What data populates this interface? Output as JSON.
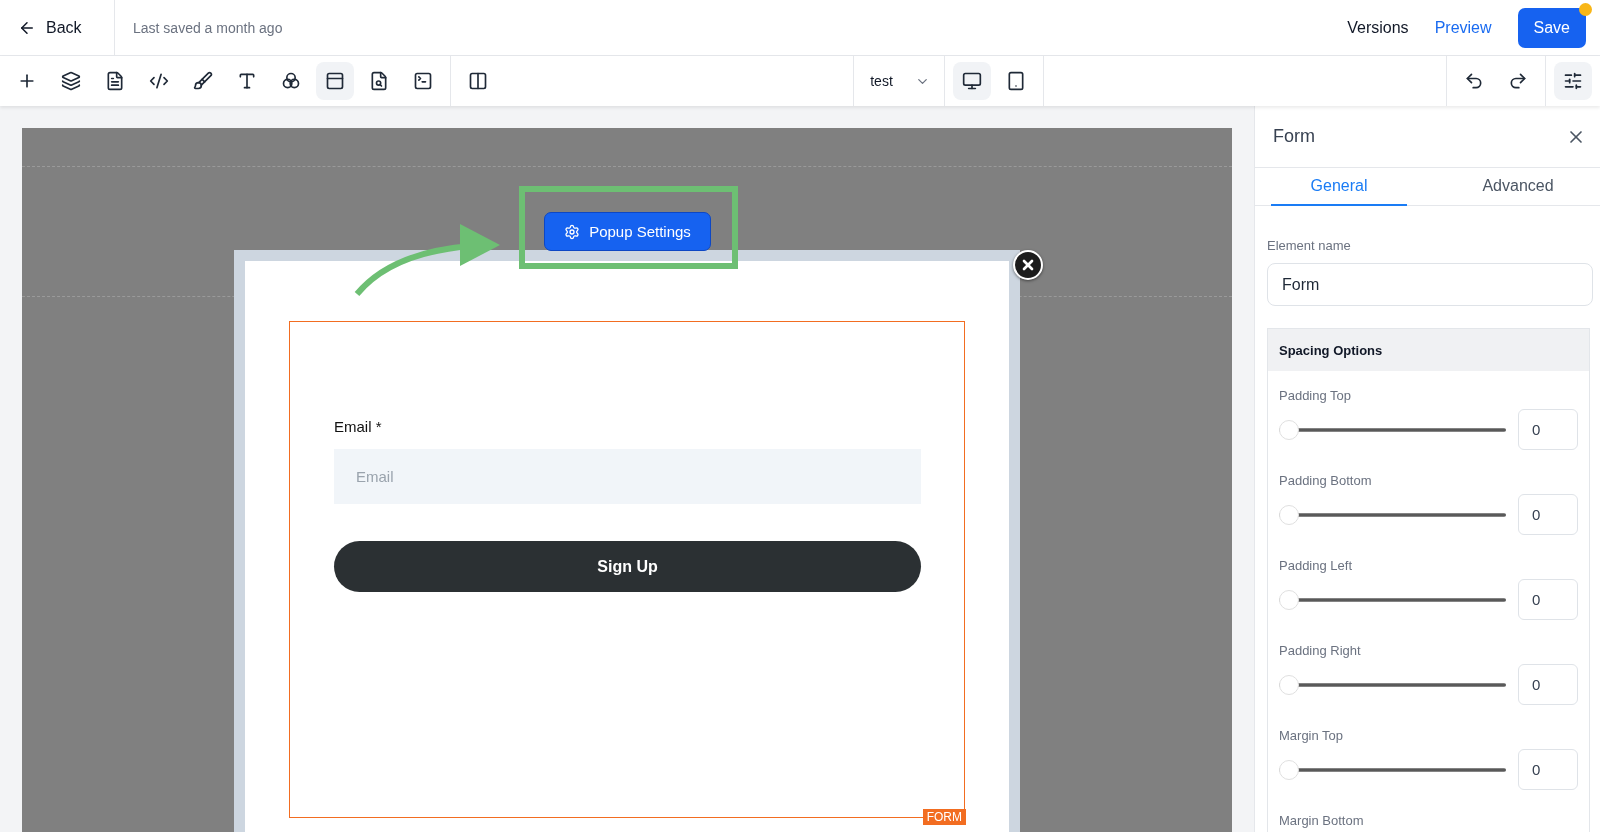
{
  "header": {
    "back": "Back",
    "saved_status": "Last saved a month ago",
    "versions": "Versions",
    "preview": "Preview",
    "save": "Save",
    "unsaved_changes": true
  },
  "toolbar": {
    "tools": [
      {
        "kind": "add",
        "selected": false
      },
      {
        "kind": "layers",
        "selected": false
      },
      {
        "kind": "page",
        "selected": false
      },
      {
        "kind": "code",
        "selected": false
      },
      {
        "kind": "brush",
        "selected": false
      },
      {
        "kind": "text",
        "selected": false
      },
      {
        "kind": "circles",
        "selected": false
      },
      {
        "kind": "popup",
        "selected": true
      },
      {
        "kind": "file-search",
        "selected": false
      },
      {
        "kind": "terminal",
        "selected": false
      }
    ],
    "layout_tools": [
      {
        "kind": "columns",
        "selected": false
      }
    ],
    "page_select": "test",
    "devices": [
      {
        "kind": "desktop",
        "selected": true
      },
      {
        "kind": "mobile",
        "selected": false
      }
    ],
    "history": [
      {
        "kind": "undo"
      },
      {
        "kind": "redo"
      }
    ],
    "settings_selected": true
  },
  "canvas": {
    "popup_settings": "Popup Settings",
    "form": {
      "email_label": "Email *",
      "email_placeholder": "Email",
      "submit": "Sign Up",
      "tag": "FORM"
    }
  },
  "panel": {
    "title": "Form",
    "tabs": [
      {
        "label": "General",
        "selected": true
      },
      {
        "label": "Advanced",
        "selected": false
      }
    ],
    "element_name_label": "Element name",
    "element_name": "Form",
    "section_title": "Spacing Options",
    "spacing": [
      {
        "label": "Padding Top",
        "level": 0,
        "value": "0"
      },
      {
        "label": "Padding Bottom",
        "level": 0,
        "value": "0"
      },
      {
        "label": "Padding Left",
        "level": 0,
        "value": "0"
      },
      {
        "label": "Padding Right",
        "level": 0,
        "value": "0"
      },
      {
        "label": "Margin Top",
        "level": 0,
        "value": "0"
      },
      {
        "label": "Margin Bottom"
      }
    ]
  }
}
